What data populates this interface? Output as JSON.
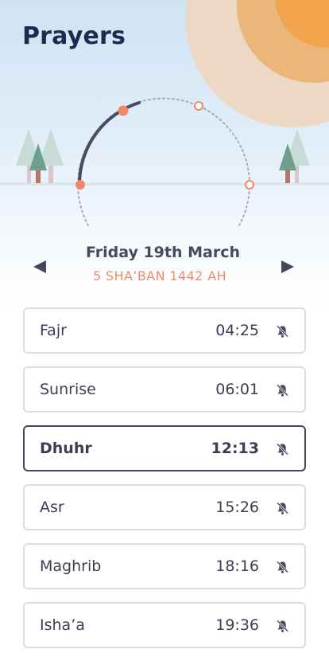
{
  "header": {
    "title": "Prayers"
  },
  "date": {
    "gregorian": "Friday 19th March",
    "hijri": "5 SHA’BAN 1442 AH"
  },
  "colors": {
    "accent": "#f08a6a",
    "text_dark": "#1e2a4f",
    "border_active": "#47465f",
    "sun": "#f2a44d"
  },
  "prayers": [
    {
      "name": "Fajr",
      "time": "04:25",
      "icon": "bell-muted-icon"
    },
    {
      "name": "Sunrise",
      "time": "06:01",
      "icon": "bell-muted-icon"
    },
    {
      "name": "Dhuhr",
      "time": "12:13",
      "icon": "bell-muted-icon",
      "current": true
    },
    {
      "name": "Asr",
      "time": "15:26",
      "icon": "bell-muted-icon"
    },
    {
      "name": "Maghrib",
      "time": "18:16",
      "icon": "bell-muted-icon"
    },
    {
      "name": "Isha’a",
      "time": "19:36",
      "icon": "bell-muted-icon"
    }
  ]
}
